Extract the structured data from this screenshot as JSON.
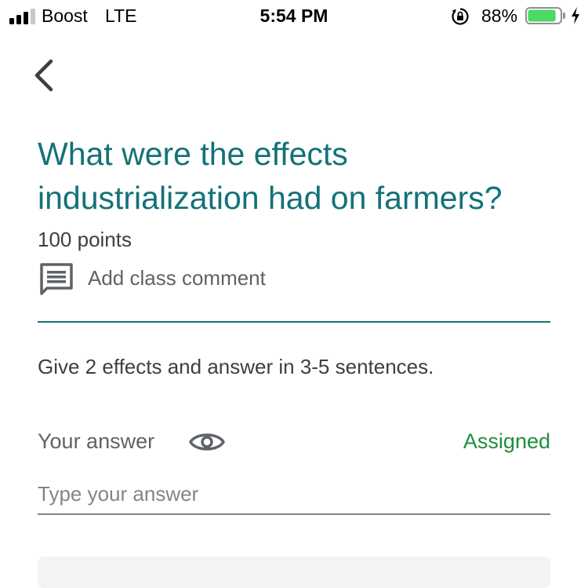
{
  "status_bar": {
    "carrier": "Boost",
    "network": "LTE",
    "time": "5:54 PM",
    "battery_percent": "88%",
    "battery_level": 0.88,
    "battery_color": "#4cd964",
    "icons": [
      "signal-icon",
      "orientation-lock-icon",
      "battery-icon",
      "charging-icon"
    ]
  },
  "nav": {
    "back_icon": "chevron-left-icon"
  },
  "assignment": {
    "title": "What were the effects industrialization had on farmers?",
    "points": "100 points",
    "comment_label": "Add class comment",
    "comment_icon": "comment-icon",
    "instructions": "Give 2 effects and answer in 3-5 sentences."
  },
  "answer": {
    "label": "Your answer",
    "visibility_icon": "eye-icon",
    "status": "Assigned",
    "placeholder": "Type your answer",
    "value": ""
  },
  "colors": {
    "accent": "#137278",
    "assigned_green": "#1e8e3e"
  }
}
